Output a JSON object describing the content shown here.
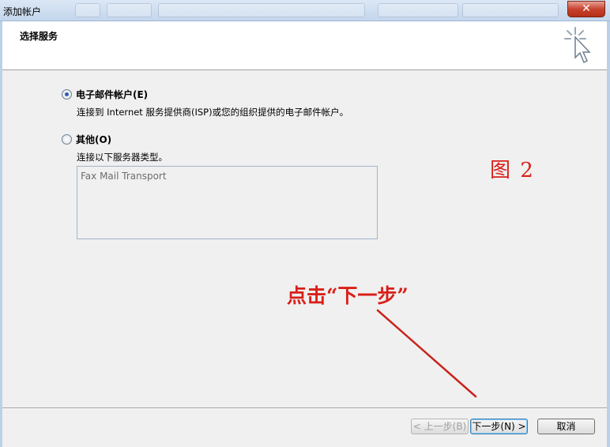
{
  "window": {
    "title": "添加帐户",
    "close_label": "✕"
  },
  "header": {
    "title": "选择服务"
  },
  "options": [
    {
      "label": "电子邮件帐户(E)",
      "description": "连接到 Internet 服务提供商(ISP)或您的组织提供的电子邮件帐户。",
      "checked": true
    },
    {
      "label": "其他(O)",
      "description": "连接以下服务器类型。",
      "checked": false
    }
  ],
  "server_list": {
    "items": [
      "Fax Mail Transport"
    ]
  },
  "annotations": {
    "figure": "图 2",
    "instruction": "点击“下一步”"
  },
  "buttons": {
    "back": "< 上一步(B)",
    "next": "下一步(N) >",
    "cancel": "取消"
  },
  "colors": {
    "annotation": "#d8201a",
    "accent": "#2a5db0"
  }
}
